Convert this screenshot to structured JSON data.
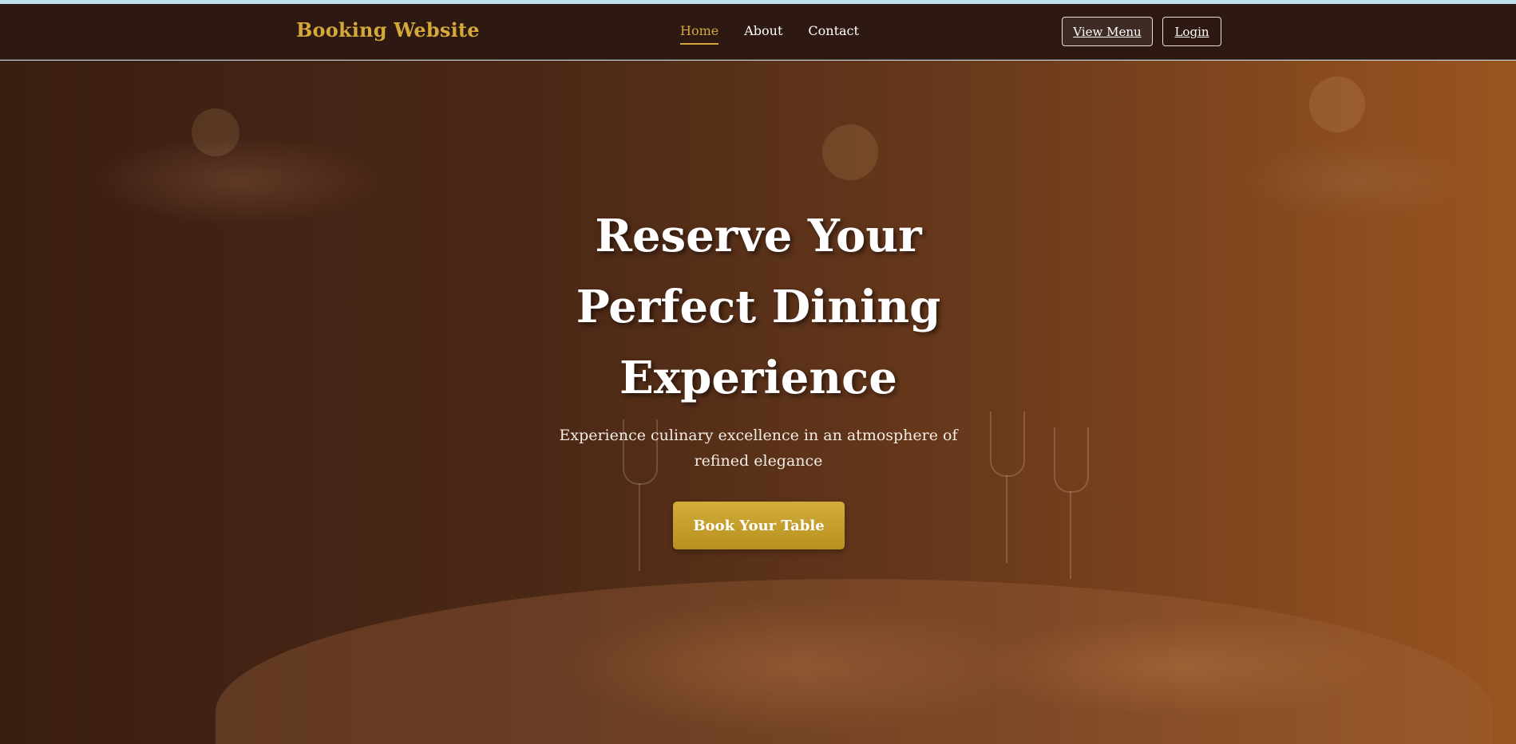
{
  "brand": {
    "name": "Booking Website"
  },
  "nav": {
    "links": [
      {
        "label": "Home"
      },
      {
        "label": "About"
      },
      {
        "label": "Contact"
      }
    ],
    "view_menu_label": "View Menu",
    "login_label": "Login"
  },
  "hero": {
    "title": "Reserve Your Perfect Dining Experience",
    "subtitle": "Experience culinary excellence in an atmosphere of refined elegance",
    "cta_label": "Book Your Table"
  },
  "colors": {
    "accent": "#d4a93a",
    "nav_background": "#2d1912",
    "button_gold": "#c9a42e"
  }
}
